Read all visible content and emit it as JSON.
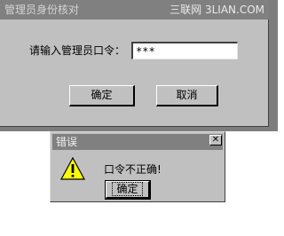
{
  "main_window": {
    "title": "管理员身份核对",
    "prompt_label": "请输入管理员口令：",
    "password_value": "***",
    "ok_label": "确定",
    "cancel_label": "取消"
  },
  "watermark": "三联网 3LIAN.COM",
  "error_dialog": {
    "title": "错误",
    "close_glyph": "✕",
    "message": "口令不正确!",
    "ok_label": "确定",
    "icon": "warning-icon"
  },
  "colors": {
    "window_bg": "#c0c0c0",
    "titlebar_bg": "#808080",
    "warning_yellow": "#ffff00"
  }
}
